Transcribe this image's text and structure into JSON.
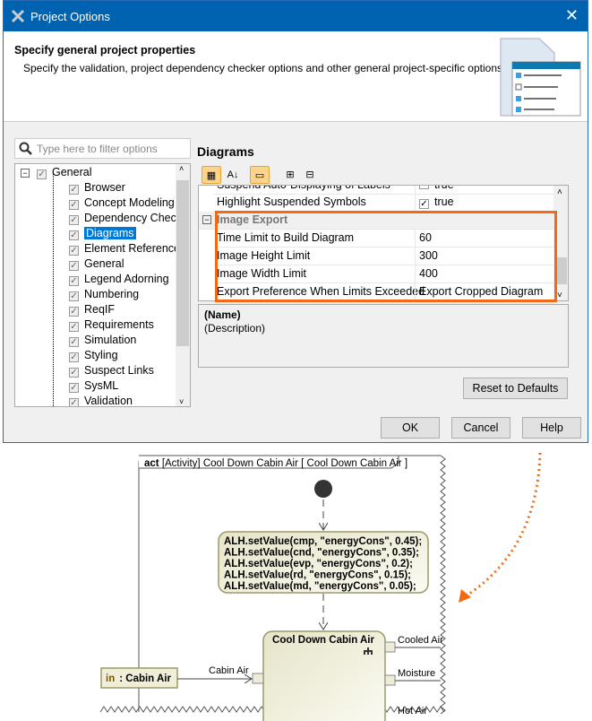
{
  "window": {
    "title": "Project Options",
    "close_icon": "close-icon"
  },
  "header": {
    "title": "Specify general project properties",
    "description": "Specify the validation, project dependency checker options and other general project-specific options."
  },
  "filter": {
    "placeholder": "Type here to filter options"
  },
  "tree": {
    "root": "General",
    "items": [
      "Browser",
      "Concept Modeling",
      "Dependency Checker",
      "Diagrams",
      "Element References",
      "General",
      "Legend Adorning",
      "Numbering",
      "ReqIF",
      "Requirements",
      "Simulation",
      "Styling",
      "Suspect Links",
      "SysML",
      "Validation"
    ],
    "selected": "Diagrams"
  },
  "section_title": "Diagrams",
  "properties": {
    "partial_row": {
      "name": "Suspend Auto-Displaying of Labels",
      "value": "true"
    },
    "highlight": {
      "name": "Highlight Suspended Symbols",
      "value": "true",
      "checked": true
    },
    "category": "Image Export",
    "rows": [
      {
        "name": "Time Limit to Build Diagram",
        "value": "60"
      },
      {
        "name": "Image Height Limit",
        "value": "300"
      },
      {
        "name": "Image Width Limit",
        "value": "400"
      },
      {
        "name": "Export Preference When Limits Exceeded",
        "value": "Export Cropped Diagram"
      }
    ]
  },
  "description": {
    "name": "(Name)",
    "text": "(Description)"
  },
  "buttons": {
    "reset": "Reset to Defaults",
    "ok": "OK",
    "cancel": "Cancel",
    "help": "Help"
  },
  "colors": {
    "titlebar": "#0063b1",
    "highlight": "#f26b12",
    "selection": "#0078d7"
  },
  "diagram": {
    "frame_label": "act [Activity] Cool Down Cabin Air [ Cool Down Cabin Air ]",
    "frame_kind": "act",
    "code": [
      "ALH.setValue(cmp, \"energyCons\", 0.45);",
      "ALH.setValue(cnd, \"energyCons\", 0.35);",
      "ALH.setValue(evp, \"energyCons\", 0.2);",
      "ALH.setValue(rd, \"energyCons\", 0.15);",
      "ALH.setValue(md, \"energyCons\", 0.05);"
    ],
    "action": "Cool Down Cabin Air",
    "param_dir": "in",
    "param": ": Cabin Air",
    "in_pin": "Cabin Air",
    "out_pins": [
      "Cooled Air",
      "Moisture",
      "Hot Air"
    ]
  }
}
